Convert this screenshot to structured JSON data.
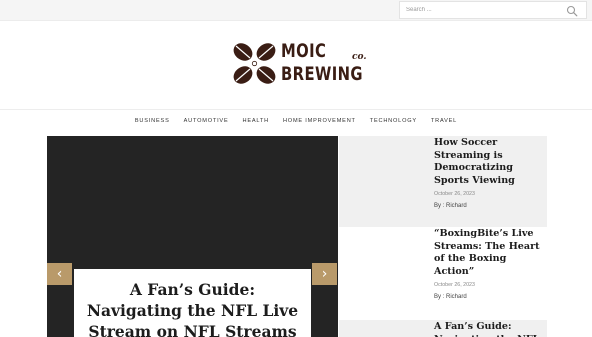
{
  "search": {
    "placeholder": "Search ..."
  },
  "brand": {
    "line1": "MOIC",
    "co": "co.",
    "line2": "BREWING"
  },
  "nav": [
    "BUSINESS",
    "AUTOMOTIVE",
    "HEALTH",
    "HOME IMPROVEMENT",
    "TECHNOLOGY",
    "TRAVEL"
  ],
  "slider": {
    "prev": "‹",
    "next": "›",
    "title": "A Fan’s Guide: Navigating the NFL Live Stream on NFL Streams"
  },
  "sidebar": [
    {
      "title": "How Soccer Streaming is Democratizing Sports Viewing",
      "date": "October 26, 2023",
      "author": "By : Richard"
    },
    {
      "title": "“BoxingBite’s Live Streams: The Heart of the Boxing Action”",
      "date": "October 26, 2023",
      "author": "By : Richard"
    },
    {
      "title": "A Fan’s Guide: Navigating the NFL"
    }
  ],
  "colors": {
    "brand": "#3a1d14",
    "accent": "#b99a6a",
    "slider_bg": "#242424"
  }
}
